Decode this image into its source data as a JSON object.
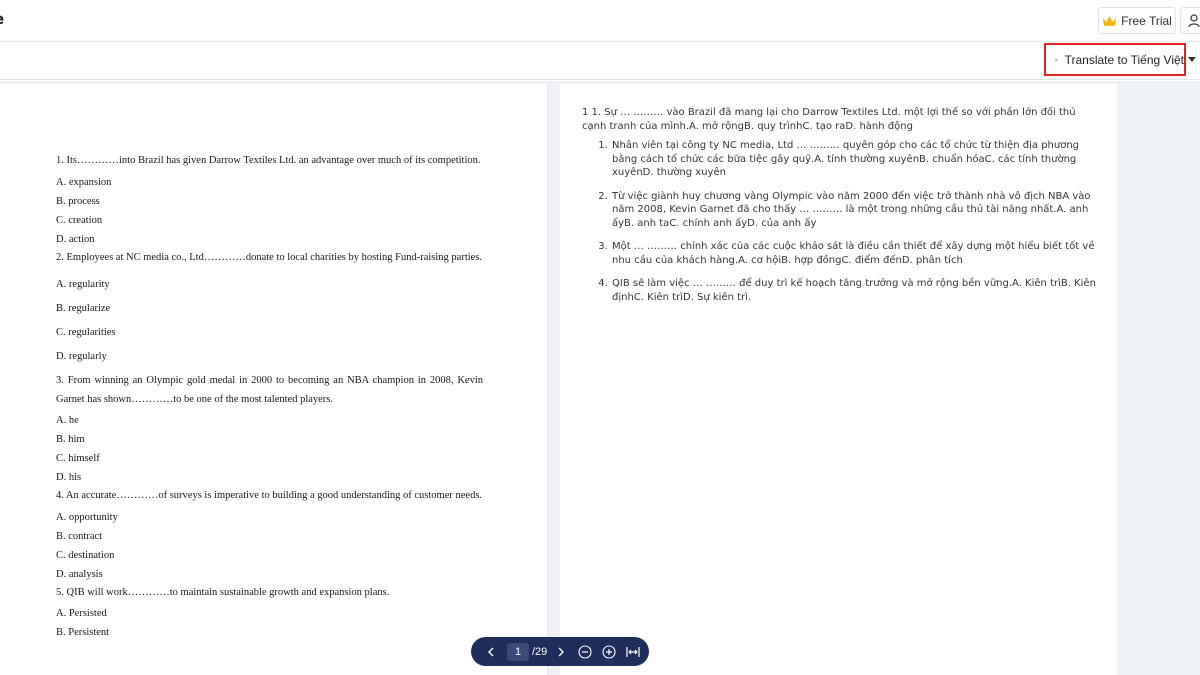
{
  "header": {
    "title": "e",
    "free_trial_label": "Free Trial"
  },
  "toolbar": {
    "translate_label": "Translate to Tiếng Việt"
  },
  "document": {
    "items": [
      {
        "question": "1.  Its…………into Brazil has given Darrow Textiles Ltd. an advantage over much of its competition.",
        "options": [
          "A.  expansion",
          "B.  process",
          "C.  creation",
          "D.  action"
        ]
      },
      {
        "question": "2.  Employees at NC media co., Ltd…………donate to local charities by hosting Fund-raising parties.",
        "options": [
          "A. regularity",
          "B. regularize",
          "C. regularities",
          "D. regularly"
        ]
      },
      {
        "question": "3.  From winning an Olympic gold medal in 2000 to becoming an NBA champion in 2008, Kevin Garnet has shown…………to be one of the most talented players.",
        "options": [
          "A.  he",
          "B.  him",
          "C.  himself",
          "D.  his"
        ]
      },
      {
        "question": "4.  An accurate…………of surveys is imperative to building a good understanding of customer needs.",
        "options": [
          "A.  opportunity",
          "B.  contract",
          "C.  destination",
          "D.  analysis"
        ]
      },
      {
        "question": "5.  QIB will work…………to maintain sustainable growth and expansion plans.",
        "options": [
          "A.  Persisted",
          "B.  Persistent"
        ]
      }
    ]
  },
  "translation": {
    "heading": "1 1. Sự … ……… vào Brazil đã mang lại cho Darrow Textiles Ltd. một lợi thế so với phần lớn đối thủ cạnh tranh của mình.A. mở rộngB. quy trìnhC. tạo raD. hành động",
    "items": [
      "Nhân viên tại công ty NC media, Ltd … ……… quyên góp cho các tổ chức từ thiện địa phương bằng cách tổ chức các bữa tiệc gây quỹ.A. tính thường xuyênB. chuẩn hóaC. các tính thường xuyênD. thường xuyên",
      "Từ việc giành huy chương vàng Olympic vào năm 2000 đến việc trở thành nhà vô địch NBA vào năm 2008, Kevin Garnet đã cho thấy … ……… là một trong những cầu thủ tài năng nhất.A. anh ấyB. anh taC. chính anh ấyD. của anh ấy",
      "Một … ……… chính xác của các cuộc khảo sát là điều cần thiết để xây dựng một hiểu biết tốt về nhu cầu của khách hàng.A. cơ hộiB. hợp đồngC. điểm đếnD. phân tích",
      "QIB sẽ làm việc … ……… để duy trì kế hoạch tăng trưởng và mở rộng bền vững.A. Kiên trìB. Kiên địnhC. Kiên trìD. Sự kiên trì."
    ]
  },
  "pager": {
    "current_page": "1",
    "total_label": "/29"
  },
  "icons": {
    "crown": "crown-icon",
    "user": "user-icon",
    "translate": "translate-icon",
    "prev": "chevron-left-icon",
    "next": "chevron-right-icon",
    "zoom_out": "zoom-out-icon",
    "zoom_in": "zoom-in-icon",
    "fit_width": "fit-width-icon"
  },
  "colors": {
    "accent_highlight": "#e02323",
    "pager_bg": "#1f2d5c",
    "workspace_bg": "#eef1f6",
    "crown": "#f4b400"
  }
}
